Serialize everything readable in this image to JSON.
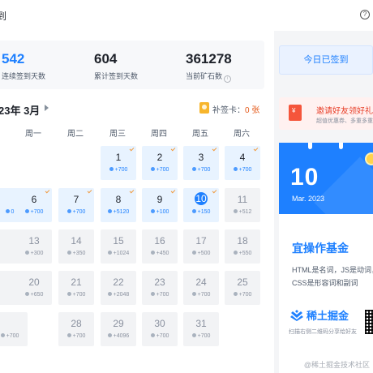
{
  "header": {
    "title": "到",
    "help_icon": "?"
  },
  "stats": [
    {
      "value": "542",
      "label": "连续签到天数"
    },
    {
      "value": "604",
      "label": "累计签到天数"
    },
    {
      "value": "361278",
      "label": "当前矿石数",
      "info_icon": "i"
    }
  ],
  "calendar": {
    "month_label": "23年 3月",
    "makeup_card_label": "补签卡：",
    "makeup_card_count": "0 张",
    "weekdays": [
      "周一",
      "周二",
      "周三",
      "周四",
      "周五",
      "周六"
    ],
    "cells": [
      {
        "day": "1",
        "points": "+700",
        "state": "signed"
      },
      {
        "day": "2",
        "points": "+700",
        "state": "signed"
      },
      {
        "day": "3",
        "points": "+700",
        "state": "signed"
      },
      {
        "day": "4",
        "points": "+700",
        "state": "signed"
      },
      {
        "day": "",
        "points": "0",
        "state": "signed"
      },
      {
        "day": "6",
        "points": "+700",
        "state": "signed"
      },
      {
        "day": "7",
        "points": "+700",
        "state": "signed"
      },
      {
        "day": "8",
        "points": "+5120",
        "state": "signed"
      },
      {
        "day": "9",
        "points": "+100",
        "state": "signed"
      },
      {
        "day": "10",
        "points": "+150",
        "state": "today"
      },
      {
        "day": "11",
        "points": "+512",
        "state": "future"
      },
      {
        "day": "13",
        "points": "+300",
        "state": "future"
      },
      {
        "day": "14",
        "points": "+350",
        "state": "future"
      },
      {
        "day": "15",
        "points": "+1024",
        "state": "future"
      },
      {
        "day": "16",
        "points": "+450",
        "state": "future"
      },
      {
        "day": "17",
        "points": "+500",
        "state": "future"
      },
      {
        "day": "18",
        "points": "+550",
        "state": "future"
      },
      {
        "day": "20",
        "points": "+650",
        "state": "future"
      },
      {
        "day": "21",
        "points": "+700",
        "state": "future"
      },
      {
        "day": "22",
        "points": "+2048",
        "state": "future"
      },
      {
        "day": "23",
        "points": "+700",
        "state": "future"
      },
      {
        "day": "24",
        "points": "+700",
        "state": "future"
      },
      {
        "day": "25",
        "points": "+700",
        "state": "future"
      },
      {
        "day": "",
        "points": "+700",
        "state": "future"
      },
      {
        "day": "28",
        "points": "+700",
        "state": "future"
      },
      {
        "day": "29",
        "points": "+4096",
        "state": "future"
      },
      {
        "day": "30",
        "points": "+700",
        "state": "future"
      },
      {
        "day": "31",
        "points": "+700",
        "state": "future"
      }
    ]
  },
  "sidebar": {
    "signin_button": "今日已签到",
    "invite_title": "邀请好友领好礼",
    "invite_sub": "超值优惠券、多重多重",
    "calendar_big": "10",
    "calendar_sub": "Mar. 2023",
    "promo_headline": "宜操作基金",
    "promo_line1": "HTML是名词，JS是动词，",
    "promo_line2": "CSS是形容词和副词",
    "brand": "稀土掘金",
    "scan_text": "扫描右侧二维码分享给好友"
  },
  "watermark": "@稀土掘金技术社区",
  "colors": {
    "accent": "#1e80ff",
    "signed_bg": "#e8f3ff",
    "future_bg": "#f2f3f5",
    "tick": "#f09a3e"
  }
}
